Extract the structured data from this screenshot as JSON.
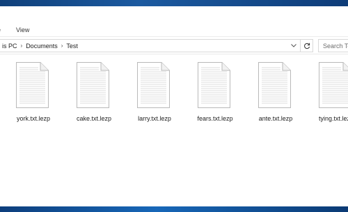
{
  "ribbon": {
    "tabs": [
      {
        "label": "e"
      },
      {
        "label": "View"
      }
    ]
  },
  "address": {
    "crumbs": [
      "is PC",
      "Documents",
      "Test"
    ],
    "separator": "›",
    "dropdown_icon": "chevron-down-icon",
    "refresh_icon": "refresh-icon"
  },
  "search": {
    "placeholder": "Search Te"
  },
  "files": [
    {
      "name": "york.txt.lezp",
      "icon": "text-document-icon"
    },
    {
      "name": "cake.txt.lezp",
      "icon": "text-document-icon"
    },
    {
      "name": "larry.txt.lezp",
      "icon": "text-document-icon"
    },
    {
      "name": "fears.txt.lezp",
      "icon": "text-document-icon"
    },
    {
      "name": "ante.txt.lezp",
      "icon": "text-document-icon"
    },
    {
      "name": "tying.txt.lezp",
      "icon": "text-document-icon"
    }
  ],
  "colors": {
    "window_bg": "#ffffff",
    "border": "#d9d9d9",
    "taskbar": "#1767b8"
  }
}
